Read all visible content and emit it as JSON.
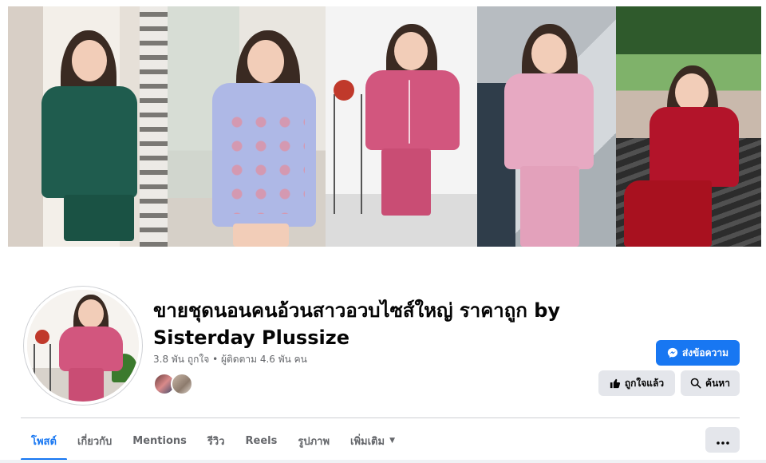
{
  "page": {
    "title": "ขายชุดนอนคนอ้วนสาวอวบไซส์ใหญ่ ราคาถูก by Sisterday Plussize",
    "stats": "3.8 พัน ถูกใจ • ผู้ติดตาม 4.6 พัน คน"
  },
  "cover": {
    "panels": [
      {
        "outfit": "green satin short-sleeve shirt and shorts",
        "color": "#1f5c4e"
      },
      {
        "outfit": "lavender printed nightshirt",
        "color": "#aeb8e6"
      },
      {
        "outfit": "pink satin long pajamas",
        "color": "#d2567e"
      },
      {
        "outfit": "light pink satin long pajamas",
        "color": "#e7a9c2"
      },
      {
        "outfit": "red satin long pajamas",
        "color": "#b3142a"
      }
    ]
  },
  "actions": {
    "message_label": "ส่งข้อความ",
    "liked_label": "ถูกใจแล้ว",
    "search_label": "ค้นหา"
  },
  "tabs": [
    {
      "label": "โพสต์",
      "active": true
    },
    {
      "label": "เกี่ยวกับ",
      "active": false
    },
    {
      "label": "Mentions",
      "active": false
    },
    {
      "label": "รีวิว",
      "active": false
    },
    {
      "label": "Reels",
      "active": false
    },
    {
      "label": "รูปภาพ",
      "active": false
    },
    {
      "label": "เพิ่มเติม",
      "active": false
    }
  ],
  "colors": {
    "accent": "#1877f2",
    "button_secondary": "#e4e6eb",
    "text_secondary": "#65676b"
  },
  "icons": {
    "message": "messenger-icon",
    "liked": "thumbs-up-icon",
    "search": "search-icon",
    "more": "more-horizontal-icon",
    "dropdown": "chevron-down-icon"
  }
}
